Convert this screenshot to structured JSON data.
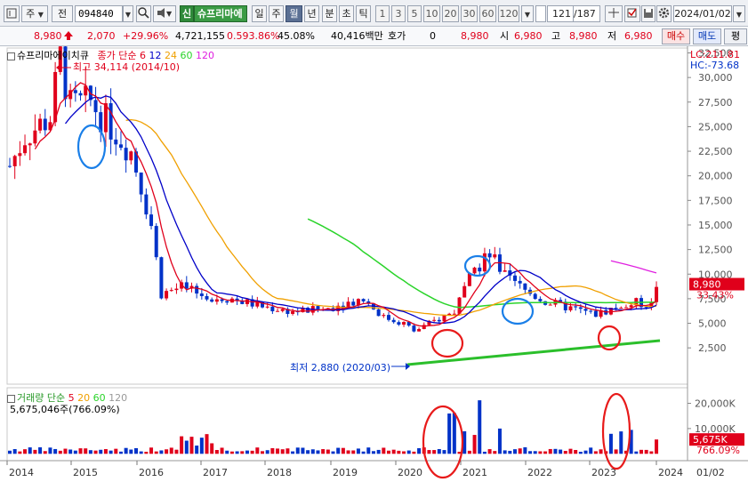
{
  "toolbar": {
    "ctrl_icon": "chart-icon",
    "market_label": "주",
    "prev_label": "전",
    "code_value": "094840",
    "search_icon": "search-icon",
    "sound_icon": "speaker-icon",
    "badge_label": "신",
    "stock_name": "슈프리마에",
    "period_tabs": [
      "일",
      "주",
      "월",
      "년",
      "분",
      "초",
      "틱"
    ],
    "active_period": "월",
    "intervals": [
      "1",
      "3",
      "5",
      "10",
      "20",
      "30",
      "60",
      "120"
    ],
    "page_value": "121",
    "page_total": "/187",
    "date_value": "2024/01/02"
  },
  "quote": {
    "price": "8,980",
    "change": "2,070",
    "change_pct": "+29.96%",
    "volume": "4,721,155",
    "vol_ratio": "0.593.86%",
    "turnover": "45.08%",
    "amount": "40,416백만",
    "hoga_label": "호가",
    "hoga_value": "0",
    "hoga_price": "8,980",
    "open_label": "시",
    "open_value": "6,980",
    "high_label": "고",
    "high_value": "8,980",
    "low_label": "저",
    "low_value": "6,980",
    "buy_label": "매수",
    "sell_label": "매도",
    "eval_label": "평"
  },
  "price_panel": {
    "stock_label": "슈프리마에이치큐",
    "ma_title": "종가 단순",
    "ma_periods": [
      "6",
      "12",
      "24",
      "60",
      "120"
    ],
    "high_annotation": "최고 34,114 (2014/10)",
    "low_annotation": "최저 2,880 (2020/03)",
    "lc_label": "LC:211.81",
    "hc_label": "HC:-73.68",
    "last_price_tag": "8,980",
    "last_pct_tag": "33.43%"
  },
  "volume_panel": {
    "title": "거래량 단순",
    "ma_periods": [
      "5",
      "20",
      "60",
      "120"
    ],
    "summary": "5,675,046주(766.09%)",
    "last_vol_tag": "5,675K",
    "last_pct_tag": "766.09%"
  },
  "x_axis": {
    "years": [
      "2014",
      "2015",
      "2016",
      "2017",
      "2018",
      "2019",
      "2020",
      "2021",
      "2022",
      "2023",
      "2024"
    ],
    "corner_label": "01/02"
  },
  "colors": {
    "up": "#e0001b",
    "down": "#0032c8",
    "ma6": "#e0001b",
    "ma12": "#0000c8",
    "ma24": "#f0a000",
    "ma60": "#2bd42b",
    "ma120": "#e020e0",
    "trendline": "#2bbf2b"
  },
  "chart_data": {
    "type": "candlestick",
    "price_axis": {
      "ticks": [
        "32,500",
        "30,000",
        "27,500",
        "25,000",
        "22,500",
        "20,000",
        "17,500",
        "15,000",
        "12,500",
        "10,000",
        "7,500",
        "5,000",
        "2,500"
      ],
      "ylim": [
        0,
        35000
      ]
    },
    "volume_axis": {
      "ticks": [
        "20,000K",
        "10,000K"
      ],
      "ylim": [
        0,
        25000
      ]
    },
    "annotations": {
      "high": {
        "date": "2014/10",
        "value": 34114
      },
      "low": {
        "date": "2020/03",
        "value": 2880
      },
      "last": {
        "value": 8980
      }
    }
  }
}
